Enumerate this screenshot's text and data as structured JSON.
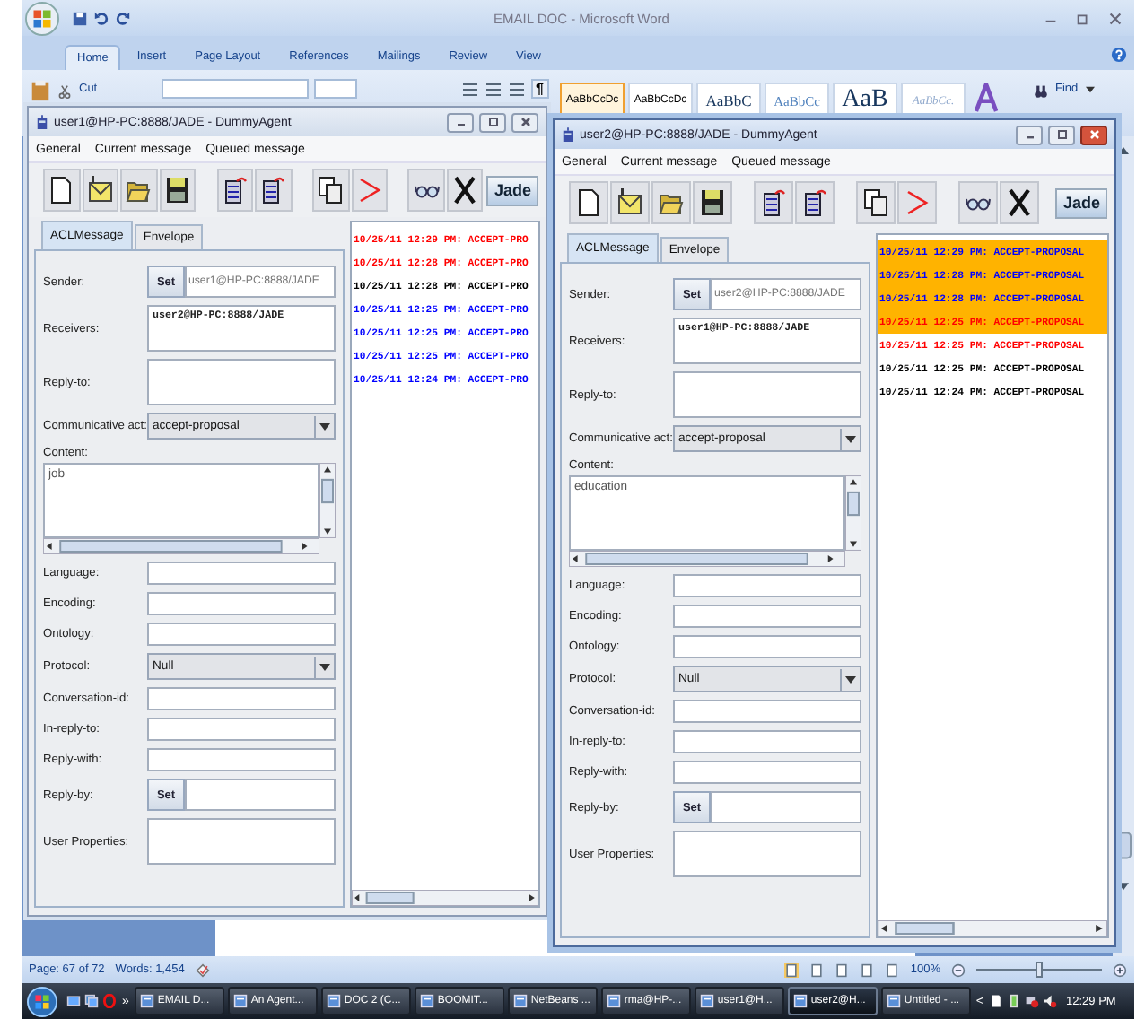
{
  "word": {
    "title": "EMAIL DOC - Microsoft Word",
    "tabs": [
      {
        "label": "Home",
        "selected": true
      },
      {
        "label": "Insert",
        "selected": false
      },
      {
        "label": "Page Layout",
        "selected": false
      },
      {
        "label": "References",
        "selected": false
      },
      {
        "label": "Mailings",
        "selected": false
      },
      {
        "label": "Review",
        "selected": false
      },
      {
        "label": "View",
        "selected": false
      }
    ],
    "cut": "Cut",
    "paragraph_mark": "¶",
    "styles": [
      {
        "sample": "AaBbCcDc",
        "kind": "normal",
        "selected": true
      },
      {
        "sample": "AaBbCcDc",
        "kind": "nospacing",
        "selected": false
      },
      {
        "sample": "AaBbC",
        "kind": "heading1",
        "selected": false
      },
      {
        "sample": "AaBbCc",
        "kind": "heading2",
        "selected": false
      },
      {
        "sample": "AaB",
        "kind": "title",
        "selected": false
      },
      {
        "sample": "AaBbCc.",
        "kind": "subtitle",
        "selected": false
      }
    ],
    "find": "Find"
  },
  "agents": [
    {
      "title": "user1@HP-PC:8888/JADE - DummyAgent",
      "active": false,
      "menu": [
        "General",
        "Current message",
        "Queued message"
      ],
      "logo_text": "Jade",
      "tabs": [
        {
          "label": "ACLMessage",
          "selected": true
        },
        {
          "label": "Envelope",
          "selected": false
        }
      ],
      "fields": [
        {
          "kind": "set",
          "label": "Sender:",
          "button": "Set",
          "value": "user1@HP-PC:8888/JADE"
        },
        {
          "kind": "area",
          "label": "Receivers:",
          "value": "user2@HP-PC:8888/JADE"
        },
        {
          "kind": "area",
          "label": "Reply-to:"
        },
        {
          "kind": "select",
          "label": "Communicative act:",
          "value": "accept-proposal"
        },
        {
          "kind": "content",
          "label": "Content:",
          "value": "job"
        },
        {
          "kind": "text",
          "label": "Language:"
        },
        {
          "kind": "text",
          "label": "Encoding:"
        },
        {
          "kind": "text",
          "label": "Ontology:"
        },
        {
          "kind": "select",
          "label": "Protocol:",
          "value": "Null"
        },
        {
          "kind": "text",
          "label": "Conversation-id:"
        },
        {
          "kind": "text",
          "label": "In-reply-to:"
        },
        {
          "kind": "text",
          "label": "Reply-with:"
        },
        {
          "kind": "set",
          "label": "Reply-by:",
          "button": "Set"
        },
        {
          "kind": "area",
          "label": "User Properties:"
        }
      ],
      "messages": [
        {
          "time": "10/25/11 12:29 PM:",
          "performative": "ACCEPT-PRO",
          "color": "#ff0000",
          "highlighted": false
        },
        {
          "time": "10/25/11 12:28 PM:",
          "performative": "ACCEPT-PRO",
          "color": "#ff0000",
          "highlighted": false
        },
        {
          "time": "10/25/11 12:28 PM:",
          "performative": "ACCEPT-PRO",
          "color": "#000000",
          "highlighted": false
        },
        {
          "time": "10/25/11 12:25 PM:",
          "performative": "ACCEPT-PRO",
          "color": "#0000ff",
          "highlighted": false
        },
        {
          "time": "10/25/11 12:25 PM:",
          "performative": "ACCEPT-PRO",
          "color": "#0000ff",
          "highlighted": false
        },
        {
          "time": "10/25/11 12:25 PM:",
          "performative": "ACCEPT-PRO",
          "color": "#0000ff",
          "highlighted": false
        },
        {
          "time": "10/25/11 12:24 PM:",
          "performative": "ACCEPT-PRO",
          "color": "#0000ff",
          "highlighted": false
        }
      ]
    },
    {
      "title": "user2@HP-PC:8888/JADE - DummyAgent",
      "active": true,
      "menu": [
        "General",
        "Current message",
        "Queued message"
      ],
      "logo_text": "Jade",
      "tabs": [
        {
          "label": "ACLMessage",
          "selected": true
        },
        {
          "label": "Envelope",
          "selected": false
        }
      ],
      "fields": [
        {
          "kind": "set",
          "label": "Sender:",
          "button": "Set",
          "value": "user2@HP-PC:8888/JADE"
        },
        {
          "kind": "area",
          "label": "Receivers:",
          "value": "user1@HP-PC:8888/JADE"
        },
        {
          "kind": "area",
          "label": "Reply-to:"
        },
        {
          "kind": "select",
          "label": "Communicative act:",
          "value": "accept-proposal"
        },
        {
          "kind": "content",
          "label": "Content:",
          "value": "education"
        },
        {
          "kind": "text",
          "label": "Language:"
        },
        {
          "kind": "text",
          "label": "Encoding:"
        },
        {
          "kind": "text",
          "label": "Ontology:"
        },
        {
          "kind": "select",
          "label": "Protocol:",
          "value": "Null"
        },
        {
          "kind": "text",
          "label": "Conversation-id:"
        },
        {
          "kind": "text",
          "label": "In-reply-to:"
        },
        {
          "kind": "text",
          "label": "Reply-with:"
        },
        {
          "kind": "set",
          "label": "Reply-by:",
          "button": "Set"
        },
        {
          "kind": "area",
          "label": "User Properties:"
        }
      ],
      "messages": [
        {
          "time": "10/25/11 12:29 PM:",
          "performative": "ACCEPT-PROPOSAL",
          "color": "#0000ff",
          "highlighted": true
        },
        {
          "time": "10/25/11 12:28 PM:",
          "performative": "ACCEPT-PROPOSAL",
          "color": "#0000ff",
          "highlighted": true
        },
        {
          "time": "10/25/11 12:28 PM:",
          "performative": "ACCEPT-PROPOSAL",
          "color": "#0000ff",
          "highlighted": true
        },
        {
          "time": "10/25/11 12:25 PM:",
          "performative": "ACCEPT-PROPOSAL",
          "color": "#ff0000",
          "highlighted": true
        },
        {
          "time": "10/25/11 12:25 PM:",
          "performative": "ACCEPT-PROPOSAL",
          "color": "#ff0000",
          "highlighted": false
        },
        {
          "time": "10/25/11 12:25 PM:",
          "performative": "ACCEPT-PROPOSAL",
          "color": "#000000",
          "highlighted": false
        },
        {
          "time": "10/25/11 12:24 PM:",
          "performative": "ACCEPT-PROPOSAL",
          "color": "#000000",
          "highlighted": false
        }
      ]
    }
  ],
  "status_bar": {
    "page": "Page: 67 of 72",
    "words": "Words: 1,454",
    "zoom": {
      "reading": "100%",
      "level": 0.5
    }
  },
  "taskbar": {
    "overflow": "»",
    "items": [
      {
        "label": "EMAIL D...",
        "selected": false
      },
      {
        "label": "An Agent...",
        "selected": false
      },
      {
        "label": "DOC 2 (C...",
        "selected": false
      },
      {
        "label": "BOOMIT...",
        "selected": false
      },
      {
        "label": "NetBeans ...",
        "selected": false
      },
      {
        "label": "rma@HP-...",
        "selected": false
      },
      {
        "label": "user1@H...",
        "selected": false
      },
      {
        "label": "user2@H...",
        "selected": true
      },
      {
        "label": "Untitled - ...",
        "selected": false
      }
    ],
    "tray_arrow": "<",
    "clock": "12:29 PM"
  }
}
